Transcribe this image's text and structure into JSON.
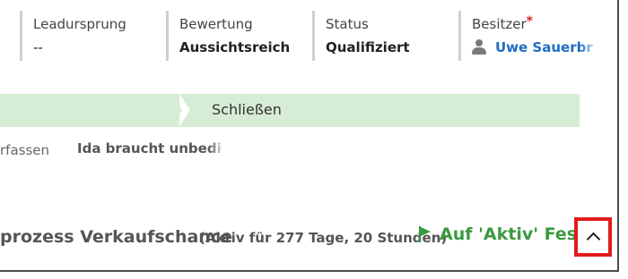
{
  "header_fields": [
    {
      "label": "Leadursprung",
      "value": "--"
    },
    {
      "label": "Bewertung",
      "value": "Aussichtsreich"
    },
    {
      "label": "Status",
      "value": "Qualifiziert"
    },
    {
      "label": "Besitzer",
      "required_mark": "*",
      "value": "Uwe Sauerbr"
    }
  ],
  "process": {
    "stage_label": "Schließen",
    "step_partial_label": "rfassen",
    "step_value": "Ida braucht unbedingt"
  },
  "footer": {
    "process_title": "prozess Verkaufschance",
    "process_duration": "(Aktiv für 277 Tage, 20 Stunden)",
    "set_active_label": "Auf 'Aktiv' Fes...",
    "collapse_icon": "chevron-up-icon"
  },
  "colors": {
    "accent_green": "#3a9a3e",
    "stage_bg": "#d7ecd4",
    "link_blue": "#1f6cc5",
    "highlight_red": "#e21b1b"
  }
}
